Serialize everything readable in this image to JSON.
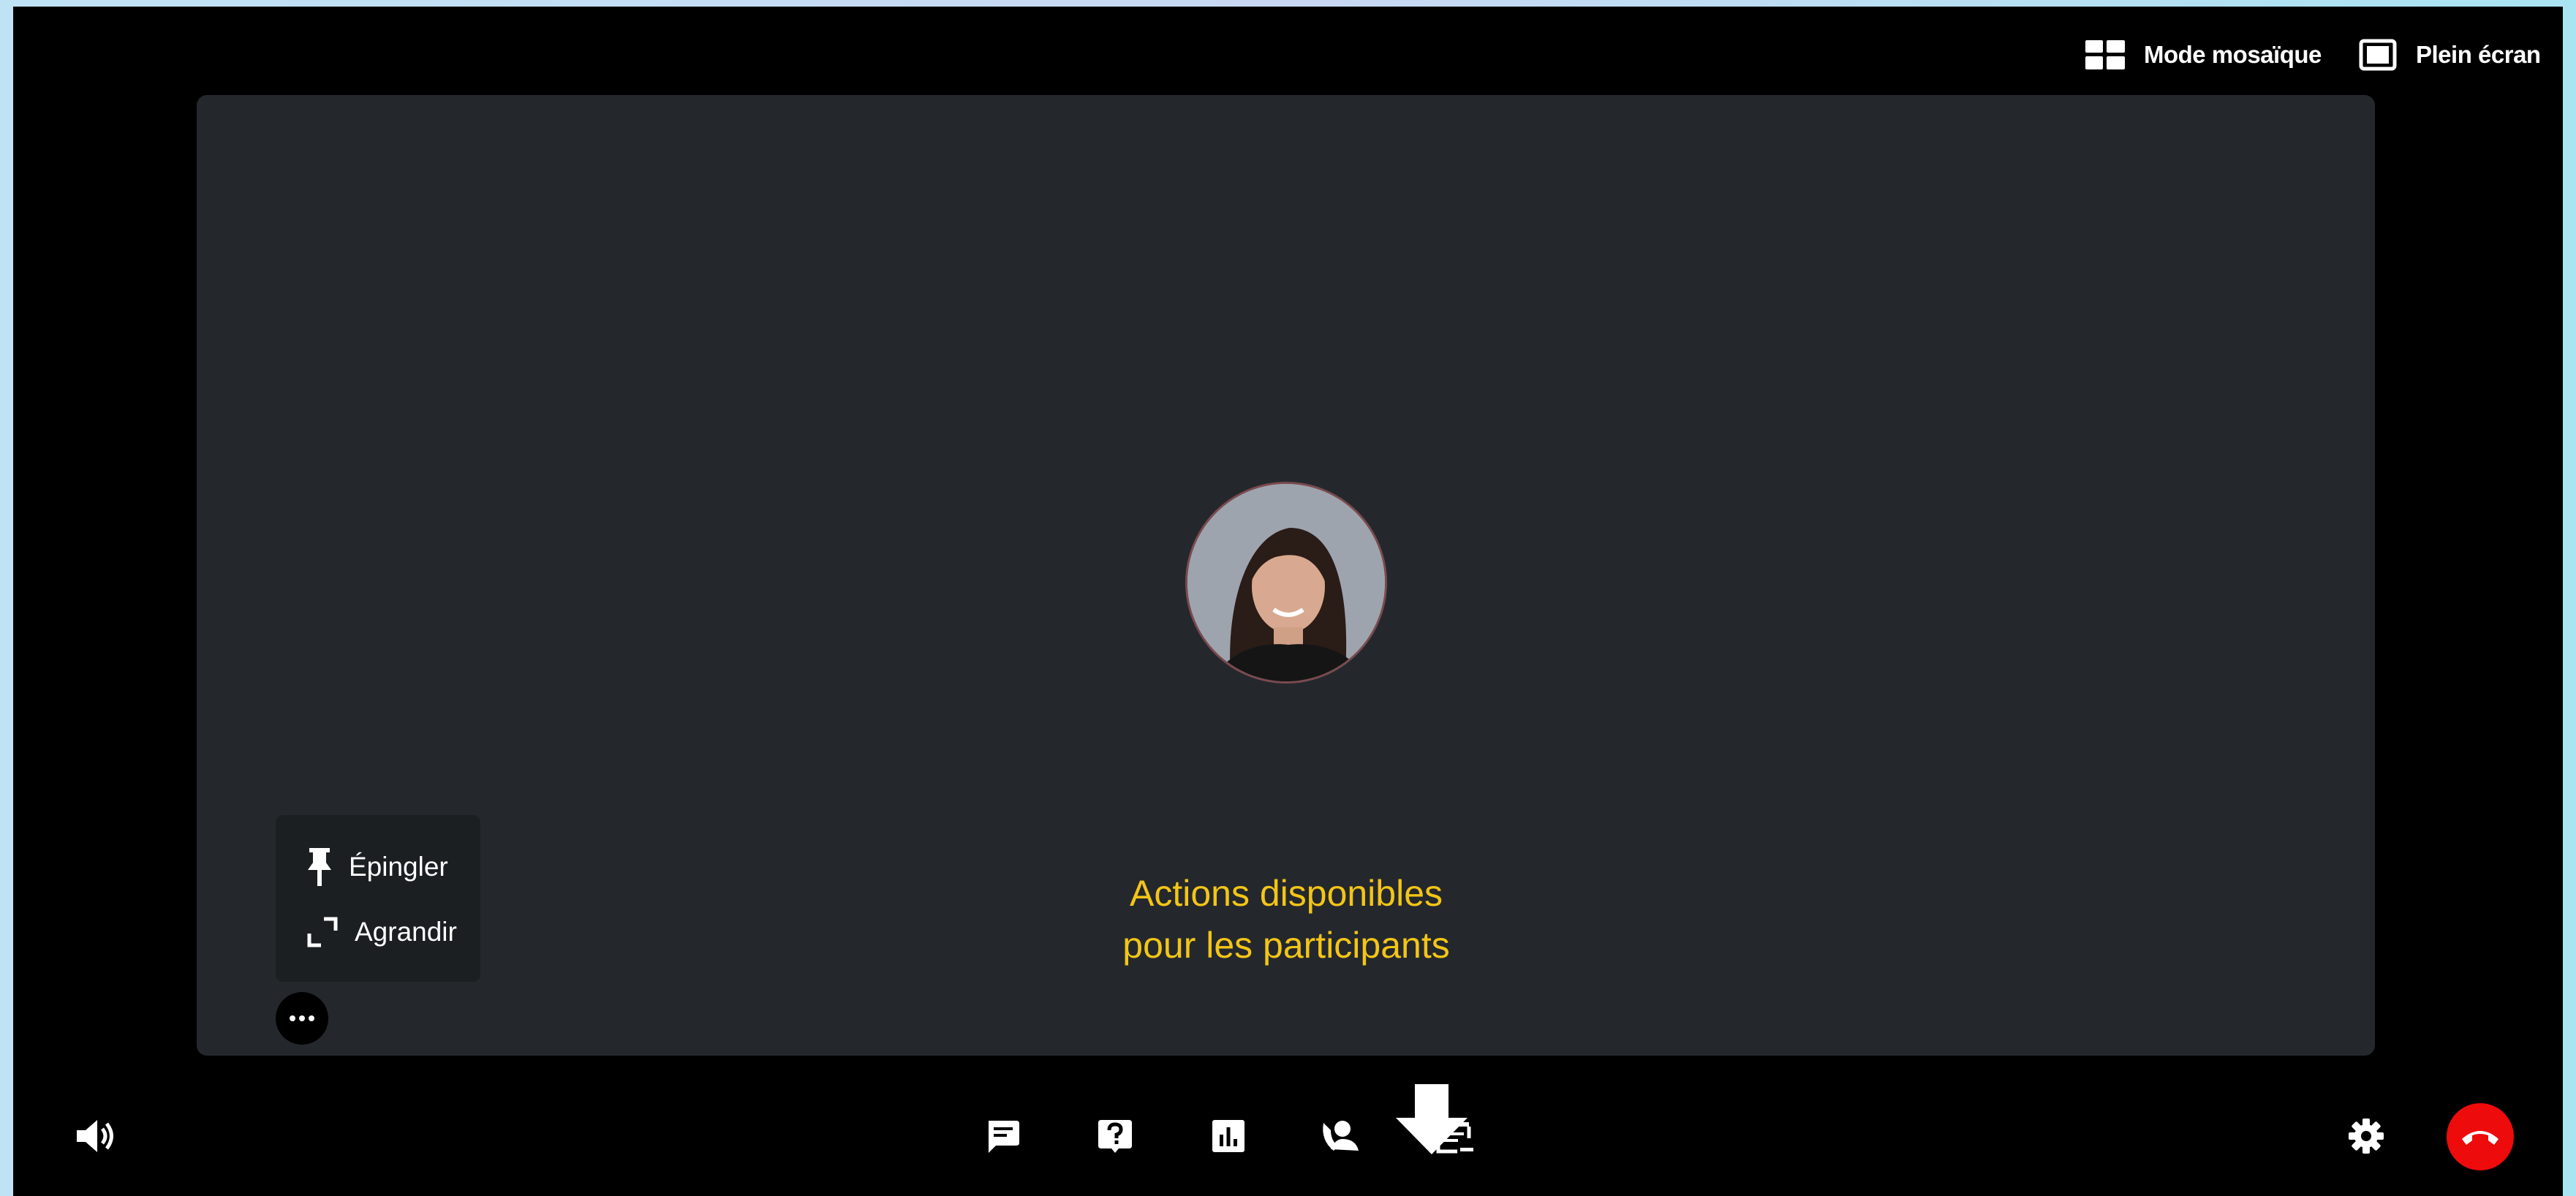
{
  "topbar": {
    "mosaic_label": "Mode mosaïque",
    "fullscreen_label": "Plein écran"
  },
  "participant_menu": {
    "pin_label": "Épingler",
    "enlarge_label": "Agrandir"
  },
  "annotation": {
    "line1": "Actions disponibles",
    "line2": "pour les participants"
  },
  "icons": {
    "mosaic": "grid-icon",
    "fullscreen": "fullscreen-icon",
    "pin": "pin-icon",
    "enlarge": "expand-icon",
    "more": "more-horizontal-icon",
    "volume": "volume-icon",
    "chat": "chat-icon",
    "question": "question-icon",
    "poll": "poll-icon",
    "contact": "contact-icon",
    "agenda": "agenda-icon",
    "settings": "gear-icon",
    "hangup": "hangup-icon"
  },
  "colors": {
    "annotation": "#f3c516",
    "hangup": "#ee0b0b",
    "stage": "#24282d"
  }
}
